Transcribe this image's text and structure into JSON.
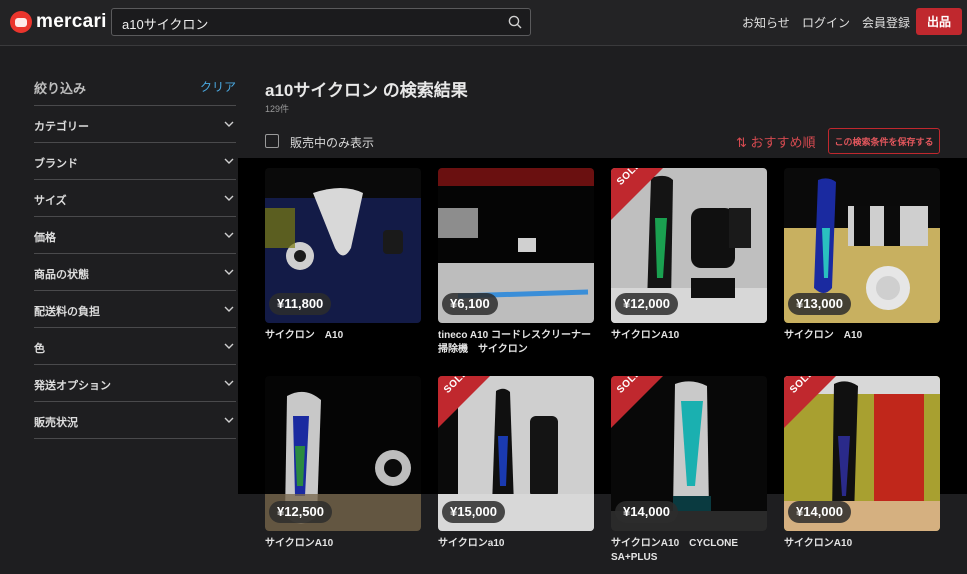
{
  "header": {
    "logo": "mercari",
    "search_value": "a10サイクロン",
    "nav": [
      "お知らせ",
      "ログイン",
      "会員登録"
    ],
    "sell_label": "出品"
  },
  "sidebar": {
    "title": "絞り込み",
    "clear": "クリア",
    "filters": [
      "カテゴリー",
      "ブランド",
      "サイズ",
      "価格",
      "商品の状態",
      "配送料の負担",
      "色",
      "発送オプション",
      "販売状況"
    ]
  },
  "results": {
    "title": "a10サイクロン の検索結果",
    "count": "129件",
    "on_sale_only": "販売中のみ表示",
    "sort": "⇅ おすすめ順",
    "save_search": "この検索条件を保存する"
  },
  "sold_label": "SOLD",
  "products": [
    {
      "price": "¥11,800",
      "name": "サイクロン　A10",
      "sold": false
    },
    {
      "price": "¥6,100",
      "name": "tineco A10 コードレスクリーナー　掃除機　サイクロン",
      "sold": false
    },
    {
      "price": "¥12,000",
      "name": "サイクロンA10",
      "sold": true
    },
    {
      "price": "¥13,000",
      "name": "サイクロン　A10",
      "sold": false
    },
    {
      "price": "¥12,500",
      "name": "サイクロンA10",
      "sold": false
    },
    {
      "price": "¥15,000",
      "name": "サイクロンa10",
      "sold": true
    },
    {
      "price": "¥14,000",
      "name": "サイクロンA10　CYCLONE SA+PLUS",
      "sold": true
    },
    {
      "price": "¥14,000",
      "name": "サイクロンA10",
      "sold": true
    }
  ],
  "colors": {
    "accent": "#c0282e",
    "link": "#4aa8e0"
  }
}
